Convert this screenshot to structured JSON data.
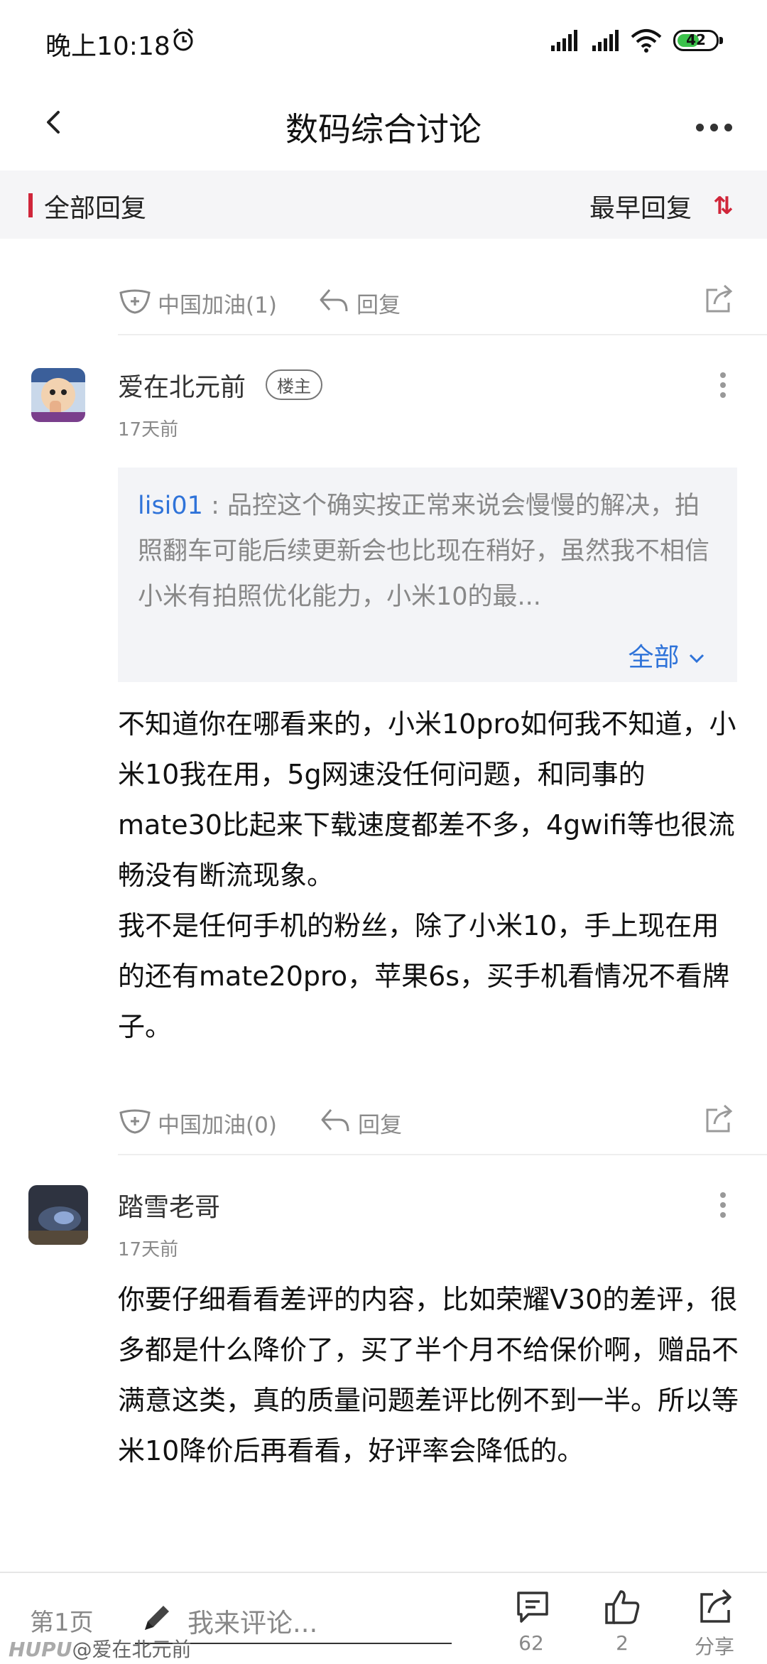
{
  "status": {
    "time": "晚上10:18",
    "battery": "42"
  },
  "header": {
    "title": "数码综合讨论"
  },
  "filter": {
    "left_label": "全部回复",
    "sort_label": "最早回复"
  },
  "top_actions": {
    "like_label": "中国加油(1)",
    "reply_label": "回复"
  },
  "posts": [
    {
      "user": "爱在北元前",
      "badge": "楼主",
      "time": "17天前",
      "quote": {
        "user": "lisi01",
        "text": " : 品控这个确实按正常来说会慢慢的解决，拍照翻车可能后续更新会也比现在稍好，虽然我不相信小米有拍照优化能力，小米10的最...",
        "expand_label": "全部"
      },
      "body": "不知道你在哪看来的，小米10pro如何我不知道，小米10我在用，5g网速没任何问题，和同事的mate30比起来下载速度都差不多，4gwifi等也很流畅没有断流现象。\n我不是任何手机的粉丝，除了小米10，手上现在用的还有mate20pro，苹果6s，买手机看情况不看牌子。",
      "like_label": "中国加油(0)",
      "reply_label": "回复"
    },
    {
      "user": "踏雪老哥",
      "time": "17天前",
      "body": "你要仔细看看差评的内容，比如荣耀V30的差评，很多都是什么降价了，买了半个月不给保价啊，赠品不满意这类，真的质量问题差评比例不到一半。所以等米10降价后再看看，好评率会降低的。"
    }
  ],
  "bottom": {
    "page": "第1页",
    "comment_placeholder": "我来评论...",
    "comments_count": "62",
    "likes_count": "2",
    "share_label": "分享",
    "watermark_brand": "HUPU",
    "watermark_user": "@爱在北元前"
  },
  "colors": {
    "accent_red": "#d0263a",
    "link_blue": "#2f73d9"
  }
}
